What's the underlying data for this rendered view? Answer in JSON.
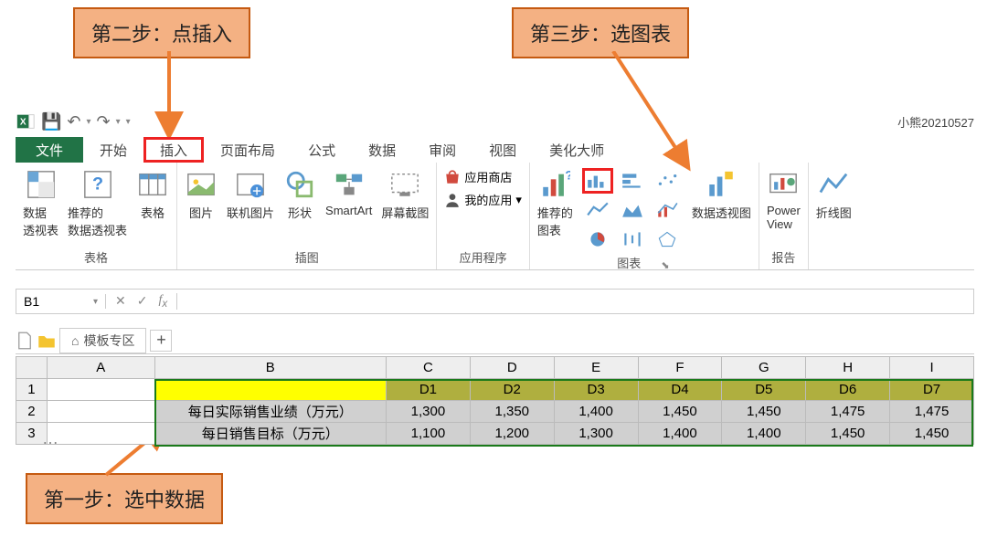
{
  "callouts": {
    "step1": "第一步：选中数据",
    "step2": "第二步：点插入",
    "step3": "第三步：选图表"
  },
  "qat": {
    "save": "保存",
    "undo": "撤销",
    "redo": "重做"
  },
  "username": "小熊20210527",
  "ribbon": {
    "tabs": {
      "file": "文件",
      "home": "开始",
      "insert": "插入",
      "layout": "页面布局",
      "formulas": "公式",
      "data": "数据",
      "review": "审阅",
      "view": "视图",
      "beautify": "美化大师"
    },
    "groups": {
      "tables": {
        "label": "表格",
        "pivot": "数据\n透视表",
        "recPivot": "推荐的\n数据透视表",
        "table": "表格"
      },
      "illustrations": {
        "label": "插图",
        "pic": "图片",
        "online": "联机图片",
        "shapes": "形状",
        "smartart": "SmartArt",
        "screenshot": "屏幕截图"
      },
      "apps": {
        "label": "应用程序",
        "store": "应用商店",
        "myapps": "我的应用"
      },
      "charts": {
        "label": "图表",
        "rec": "推荐的\n图表",
        "pivotchart": "数据透视图"
      },
      "reports": {
        "label": "报告",
        "power": "Power\nView"
      },
      "sparklines": {
        "line": "折线图"
      }
    }
  },
  "namebox": "B1",
  "sheetTabs": {
    "template": "模板专区"
  },
  "gridHeaders": [
    "A",
    "B",
    "C",
    "D",
    "E",
    "F",
    "G",
    "H",
    "I"
  ],
  "rowLabels": [
    "1",
    "2",
    "3"
  ],
  "table": {
    "headers": [
      "",
      "D1",
      "D2",
      "D3",
      "D4",
      "D5",
      "D6",
      "D7"
    ],
    "rows": [
      {
        "label": "每日实际销售业绩（万元）",
        "values": [
          "1,300",
          "1,350",
          "1,400",
          "1,450",
          "1,450",
          "1,475",
          "1,475"
        ]
      },
      {
        "label": "每日销售目标（万元）",
        "values": [
          "1,100",
          "1,200",
          "1,300",
          "1,400",
          "1,400",
          "1,450",
          "1,450"
        ]
      }
    ]
  }
}
